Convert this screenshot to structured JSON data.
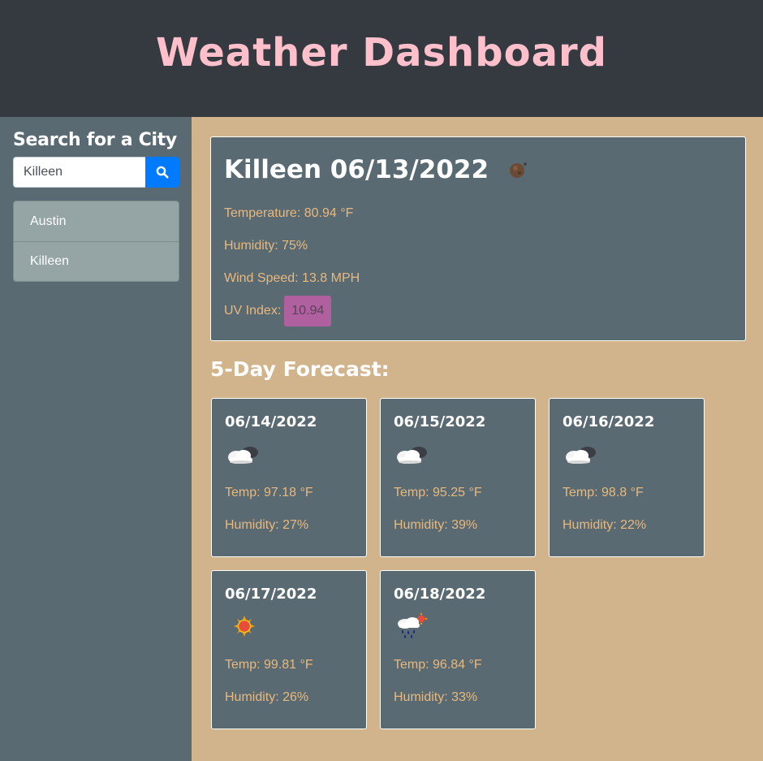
{
  "header": {
    "title": "Weather Dashboard"
  },
  "sidebar": {
    "heading": "Search for a City",
    "search": {
      "value": "Killeen",
      "button_icon": "search-icon"
    },
    "history": [
      {
        "label": "Austin"
      },
      {
        "label": "Killeen"
      }
    ]
  },
  "current": {
    "title": "Killeen 06/13/2022",
    "icon": "haze-night-icon",
    "temperature": "Temperature: 80.94 °F",
    "humidity": "Humidity: 75%",
    "wind": "Wind Speed: 13.8 MPH",
    "uv_label": "UV Index:",
    "uv_value": "10.94",
    "uv_color": "#b0609f"
  },
  "forecast": {
    "heading": "5-Day Forecast:",
    "days": [
      {
        "date": "06/14/2022",
        "icon": "cloud-night-icon",
        "temp": "Temp: 97.18 °F",
        "humidity": "Humidity: 27%"
      },
      {
        "date": "06/15/2022",
        "icon": "cloud-night-icon",
        "temp": "Temp: 95.25 °F",
        "humidity": "Humidity: 39%"
      },
      {
        "date": "06/16/2022",
        "icon": "cloud-night-icon",
        "temp": "Temp: 98.8 °F",
        "humidity": "Humidity: 22%"
      },
      {
        "date": "06/17/2022",
        "icon": "sun-icon",
        "temp": "Temp: 99.81 °F",
        "humidity": "Humidity: 26%"
      },
      {
        "date": "06/18/2022",
        "icon": "rain-sun-icon",
        "temp": "Temp: 96.84 °F",
        "humidity": "Humidity: 33%"
      }
    ]
  },
  "colors": {
    "header_bg": "#343a40",
    "title": "#ffc0cb",
    "page_bg": "#d2b48c",
    "panel_bg": "#5a6a72",
    "accent_button": "#007bff",
    "stat_text": "#e8b97e"
  }
}
